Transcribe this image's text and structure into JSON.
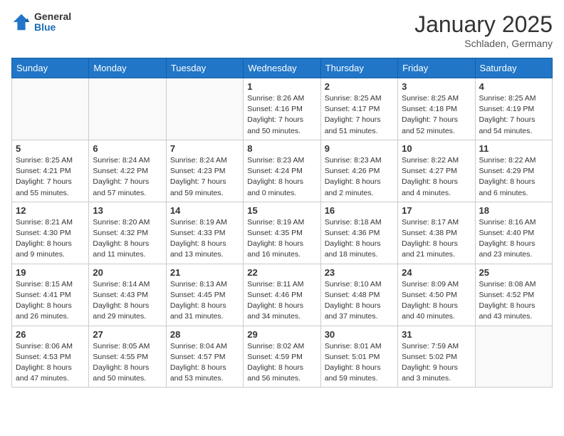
{
  "header": {
    "logo_general": "General",
    "logo_blue": "Blue",
    "month_year": "January 2025",
    "location": "Schladen, Germany"
  },
  "weekdays": [
    "Sunday",
    "Monday",
    "Tuesday",
    "Wednesday",
    "Thursday",
    "Friday",
    "Saturday"
  ],
  "weeks": [
    [
      {
        "day": "",
        "info": ""
      },
      {
        "day": "",
        "info": ""
      },
      {
        "day": "",
        "info": ""
      },
      {
        "day": "1",
        "info": "Sunrise: 8:26 AM\nSunset: 4:16 PM\nDaylight: 7 hours\nand 50 minutes."
      },
      {
        "day": "2",
        "info": "Sunrise: 8:25 AM\nSunset: 4:17 PM\nDaylight: 7 hours\nand 51 minutes."
      },
      {
        "day": "3",
        "info": "Sunrise: 8:25 AM\nSunset: 4:18 PM\nDaylight: 7 hours\nand 52 minutes."
      },
      {
        "day": "4",
        "info": "Sunrise: 8:25 AM\nSunset: 4:19 PM\nDaylight: 7 hours\nand 54 minutes."
      }
    ],
    [
      {
        "day": "5",
        "info": "Sunrise: 8:25 AM\nSunset: 4:21 PM\nDaylight: 7 hours\nand 55 minutes."
      },
      {
        "day": "6",
        "info": "Sunrise: 8:24 AM\nSunset: 4:22 PM\nDaylight: 7 hours\nand 57 minutes."
      },
      {
        "day": "7",
        "info": "Sunrise: 8:24 AM\nSunset: 4:23 PM\nDaylight: 7 hours\nand 59 minutes."
      },
      {
        "day": "8",
        "info": "Sunrise: 8:23 AM\nSunset: 4:24 PM\nDaylight: 8 hours\nand 0 minutes."
      },
      {
        "day": "9",
        "info": "Sunrise: 8:23 AM\nSunset: 4:26 PM\nDaylight: 8 hours\nand 2 minutes."
      },
      {
        "day": "10",
        "info": "Sunrise: 8:22 AM\nSunset: 4:27 PM\nDaylight: 8 hours\nand 4 minutes."
      },
      {
        "day": "11",
        "info": "Sunrise: 8:22 AM\nSunset: 4:29 PM\nDaylight: 8 hours\nand 6 minutes."
      }
    ],
    [
      {
        "day": "12",
        "info": "Sunrise: 8:21 AM\nSunset: 4:30 PM\nDaylight: 8 hours\nand 9 minutes."
      },
      {
        "day": "13",
        "info": "Sunrise: 8:20 AM\nSunset: 4:32 PM\nDaylight: 8 hours\nand 11 minutes."
      },
      {
        "day": "14",
        "info": "Sunrise: 8:19 AM\nSunset: 4:33 PM\nDaylight: 8 hours\nand 13 minutes."
      },
      {
        "day": "15",
        "info": "Sunrise: 8:19 AM\nSunset: 4:35 PM\nDaylight: 8 hours\nand 16 minutes."
      },
      {
        "day": "16",
        "info": "Sunrise: 8:18 AM\nSunset: 4:36 PM\nDaylight: 8 hours\nand 18 minutes."
      },
      {
        "day": "17",
        "info": "Sunrise: 8:17 AM\nSunset: 4:38 PM\nDaylight: 8 hours\nand 21 minutes."
      },
      {
        "day": "18",
        "info": "Sunrise: 8:16 AM\nSunset: 4:40 PM\nDaylight: 8 hours\nand 23 minutes."
      }
    ],
    [
      {
        "day": "19",
        "info": "Sunrise: 8:15 AM\nSunset: 4:41 PM\nDaylight: 8 hours\nand 26 minutes."
      },
      {
        "day": "20",
        "info": "Sunrise: 8:14 AM\nSunset: 4:43 PM\nDaylight: 8 hours\nand 29 minutes."
      },
      {
        "day": "21",
        "info": "Sunrise: 8:13 AM\nSunset: 4:45 PM\nDaylight: 8 hours\nand 31 minutes."
      },
      {
        "day": "22",
        "info": "Sunrise: 8:11 AM\nSunset: 4:46 PM\nDaylight: 8 hours\nand 34 minutes."
      },
      {
        "day": "23",
        "info": "Sunrise: 8:10 AM\nSunset: 4:48 PM\nDaylight: 8 hours\nand 37 minutes."
      },
      {
        "day": "24",
        "info": "Sunrise: 8:09 AM\nSunset: 4:50 PM\nDaylight: 8 hours\nand 40 minutes."
      },
      {
        "day": "25",
        "info": "Sunrise: 8:08 AM\nSunset: 4:52 PM\nDaylight: 8 hours\nand 43 minutes."
      }
    ],
    [
      {
        "day": "26",
        "info": "Sunrise: 8:06 AM\nSunset: 4:53 PM\nDaylight: 8 hours\nand 47 minutes."
      },
      {
        "day": "27",
        "info": "Sunrise: 8:05 AM\nSunset: 4:55 PM\nDaylight: 8 hours\nand 50 minutes."
      },
      {
        "day": "28",
        "info": "Sunrise: 8:04 AM\nSunset: 4:57 PM\nDaylight: 8 hours\nand 53 minutes."
      },
      {
        "day": "29",
        "info": "Sunrise: 8:02 AM\nSunset: 4:59 PM\nDaylight: 8 hours\nand 56 minutes."
      },
      {
        "day": "30",
        "info": "Sunrise: 8:01 AM\nSunset: 5:01 PM\nDaylight: 8 hours\nand 59 minutes."
      },
      {
        "day": "31",
        "info": "Sunrise: 7:59 AM\nSunset: 5:02 PM\nDaylight: 9 hours\nand 3 minutes."
      },
      {
        "day": "",
        "info": ""
      }
    ]
  ]
}
